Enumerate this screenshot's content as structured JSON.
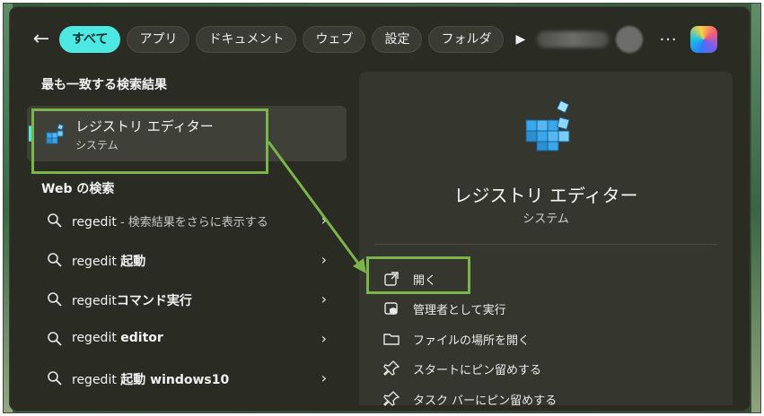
{
  "filters": {
    "back_label": "←",
    "tabs": [
      "すべて",
      "アプリ",
      "ドキュメント",
      "ウェブ",
      "設定",
      "フォルダ"
    ],
    "active_index": 0,
    "play_label": "▶",
    "more_label": "···"
  },
  "best_match": {
    "section_title": "最も一致する検索結果",
    "title": "レジストリ エディター",
    "subtitle": "システム"
  },
  "web": {
    "section_title": "Web の検索",
    "results": [
      {
        "query": "regedit",
        "suffix": " - 検索結果をさらに表示する",
        "bold": ""
      },
      {
        "query": "regedit ",
        "suffix": "",
        "bold": "起動"
      },
      {
        "query": "regedit",
        "suffix": "",
        "bold": "コマンド実行"
      },
      {
        "query": "regedit ",
        "suffix": "",
        "bold": "editor"
      },
      {
        "query": "regedit ",
        "suffix": "",
        "bold": "起動 windows10"
      }
    ],
    "chevron": "›"
  },
  "detail": {
    "app_name": "レジストリ エディター",
    "app_sub": "システム",
    "actions": [
      {
        "label": "開く",
        "icon": "open-external-icon"
      },
      {
        "label": "管理者として実行",
        "icon": "admin-shield-icon"
      },
      {
        "label": "ファイルの場所を開く",
        "icon": "folder-icon"
      },
      {
        "label": "スタートにピン留めする",
        "icon": "pin-icon"
      },
      {
        "label": "タスク バーにピン留めする",
        "icon": "pin-icon"
      }
    ]
  },
  "colors": {
    "accent": "#4ee8e3",
    "highlight": "#7bb449",
    "panel": "#2a2b23"
  }
}
